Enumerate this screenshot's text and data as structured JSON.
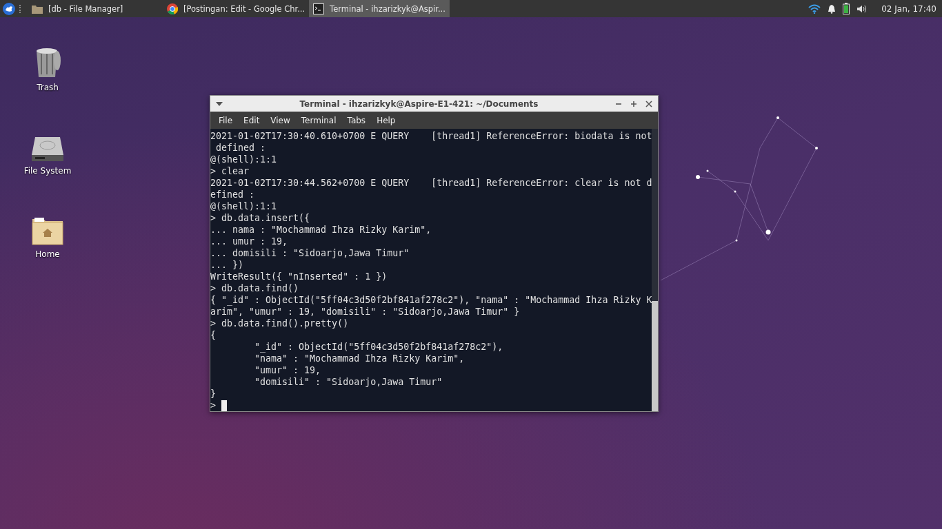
{
  "taskbar": {
    "tasks": [
      {
        "kind": "folder",
        "label": "[db - File Manager]",
        "selected": false
      },
      {
        "kind": "browser",
        "label": "[Postingan: Edit - Google Chr...",
        "selected": false
      },
      {
        "kind": "terminal",
        "label": "Terminal - ihzarizkyk@Aspir...",
        "selected": true
      }
    ],
    "clock": "02 Jan, 17:40"
  },
  "desktop_icons": [
    {
      "kind": "trash",
      "label": "Trash"
    },
    {
      "kind": "drive",
      "label": "File System"
    },
    {
      "kind": "home",
      "label": "Home"
    }
  ],
  "window": {
    "title": "Terminal - ihzarizkyk@Aspire-E1-421: ~/Documents",
    "menu": [
      "File",
      "Edit",
      "View",
      "Terminal",
      "Tabs",
      "Help"
    ],
    "lines": [
      "2021-01-02T17:30:40.610+0700 E QUERY    [thread1] ReferenceError: biodata is not",
      " defined :",
      "@(shell):1:1",
      "> clear",
      "2021-01-02T17:30:44.562+0700 E QUERY    [thread1] ReferenceError: clear is not d",
      "efined :",
      "@(shell):1:1",
      "> db.data.insert({",
      "... nama : \"Mochammad Ihza Rizky Karim\",",
      "... umur : 19,",
      "... domisili : \"Sidoarjo,Jawa Timur\"",
      "... })",
      "WriteResult({ \"nInserted\" : 1 })",
      "> db.data.find()",
      "{ \"_id\" : ObjectId(\"5ff04c3d50f2bf841af278c2\"), \"nama\" : \"Mochammad Ihza Rizky K",
      "arim\", \"umur\" : 19, \"domisili\" : \"Sidoarjo,Jawa Timur\" }",
      "> db.data.find().pretty()",
      "{",
      "        \"_id\" : ObjectId(\"5ff04c3d50f2bf841af278c2\"),",
      "        \"nama\" : \"Mochammad Ihza Rizky Karim\",",
      "        \"umur\" : 19,",
      "        \"domisili\" : \"Sidoarjo,Jawa Timur\"",
      "}"
    ],
    "prompt": ">"
  }
}
